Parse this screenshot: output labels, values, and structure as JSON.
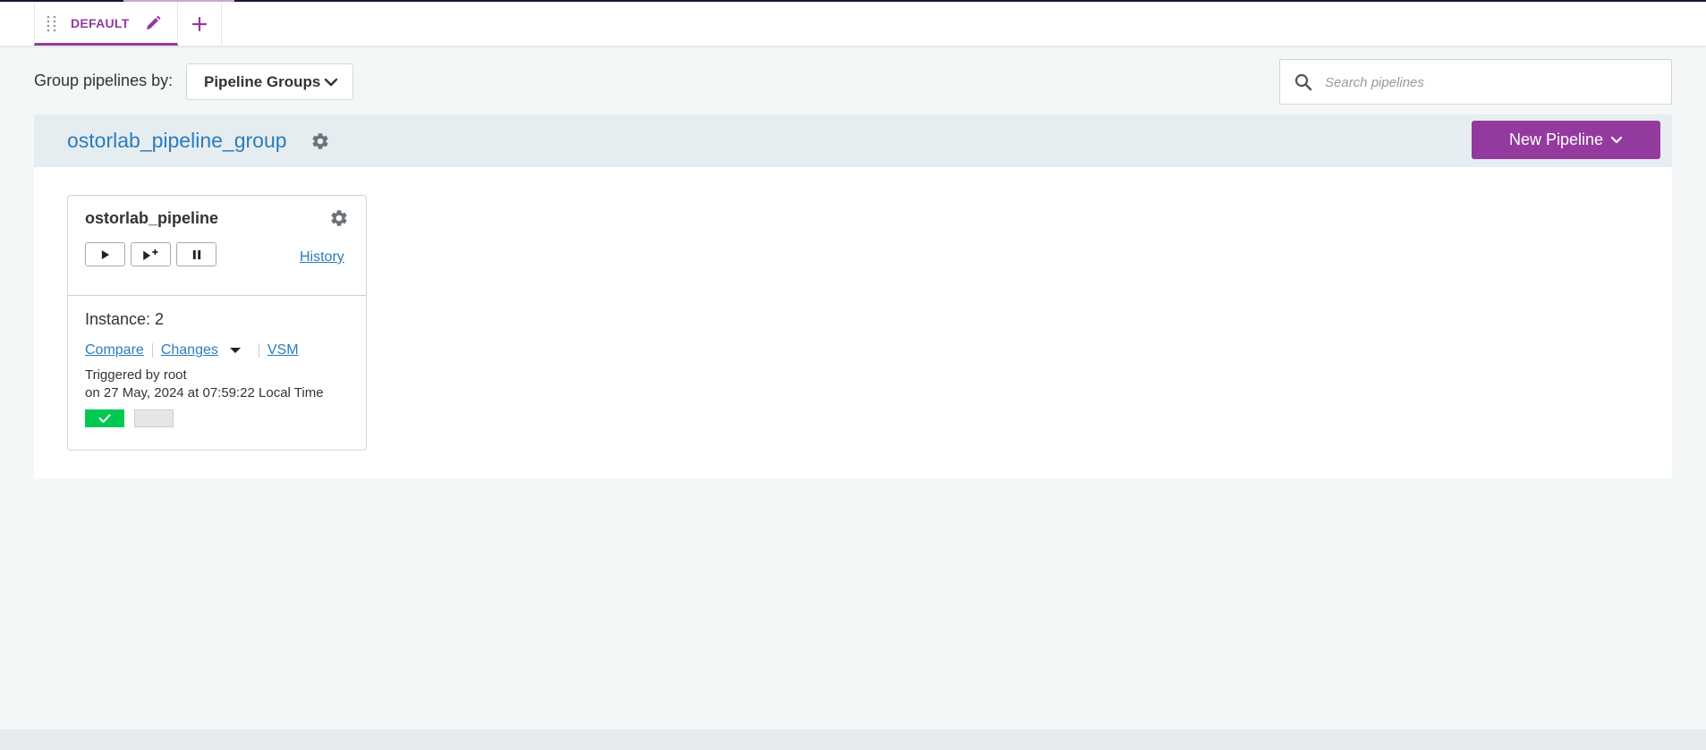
{
  "tabs": [
    {
      "name": "DEFAULT",
      "active": true
    }
  ],
  "toolbar": {
    "groupby_label": "Group pipelines by:",
    "groupby_value": "Pipeline Groups",
    "search_placeholder": "Search pipelines"
  },
  "group": {
    "name": "ostorlab_pipeline_group",
    "new_pipeline_label": "New Pipeline",
    "pipelines": [
      {
        "name": "ostorlab_pipeline",
        "history_label": "History",
        "instance_text": "Instance: 2",
        "compare_label": "Compare",
        "changes_label": "Changes",
        "vsm_label": "VSM",
        "triggered_by": "Triggered by root",
        "triggered_on": "on 27 May, 2024 at 07:59:22 Local Time",
        "stages": [
          {
            "status": "passed"
          },
          {
            "status": "unknown"
          }
        ]
      }
    ]
  },
  "colors": {
    "brand": "#943a9e",
    "link": "#2a7cbf",
    "passed": "#00c853",
    "background": "#f4f7f8"
  }
}
